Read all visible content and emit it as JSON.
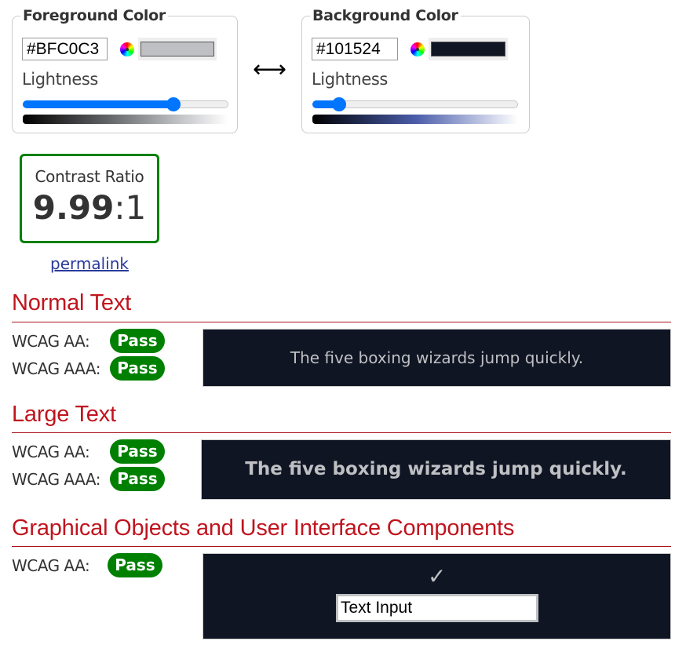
{
  "foreground": {
    "legend": "Foreground Color",
    "hex": "#BFC0C3",
    "color": "#bfc0c3",
    "picker_icon": "color-wheel-icon",
    "lightness_label": "Lightness",
    "lightness_percent": 75
  },
  "swap_icon": {
    "icon": "left-right-arrow-icon",
    "glyph": "⟷"
  },
  "background": {
    "legend": "Background Color",
    "hex": "#101524",
    "color": "#101524",
    "picker_icon": "color-wheel-icon",
    "lightness_label": "Lightness",
    "lightness_percent": 10
  },
  "contrast": {
    "title": "Contrast Ratio",
    "ratio_bold": "9.99",
    "ratio_suffix": ":1",
    "permalink": "permalink"
  },
  "sections": {
    "normal": {
      "title": "Normal Text",
      "aa_label": "WCAG AA:",
      "aa_result": "Pass",
      "aaa_label": "WCAG AAA:",
      "aaa_result": "Pass",
      "sample_text": "The five boxing wizards jump quickly."
    },
    "large": {
      "title": "Large Text",
      "aa_label": "WCAG AA:",
      "aa_result": "Pass",
      "aaa_label": "WCAG AAA:",
      "aaa_result": "Pass",
      "sample_text": "The five boxing wizards jump quickly."
    },
    "graphical": {
      "title": "Graphical Objects and User Interface Components",
      "aa_label": "WCAG AA:",
      "aa_result": "Pass",
      "check_glyph": "✓",
      "input_value": "Text Input"
    }
  },
  "colors": {
    "pass": "#008000",
    "heading": "#c0141e",
    "slider_accent": "#0075ff"
  }
}
